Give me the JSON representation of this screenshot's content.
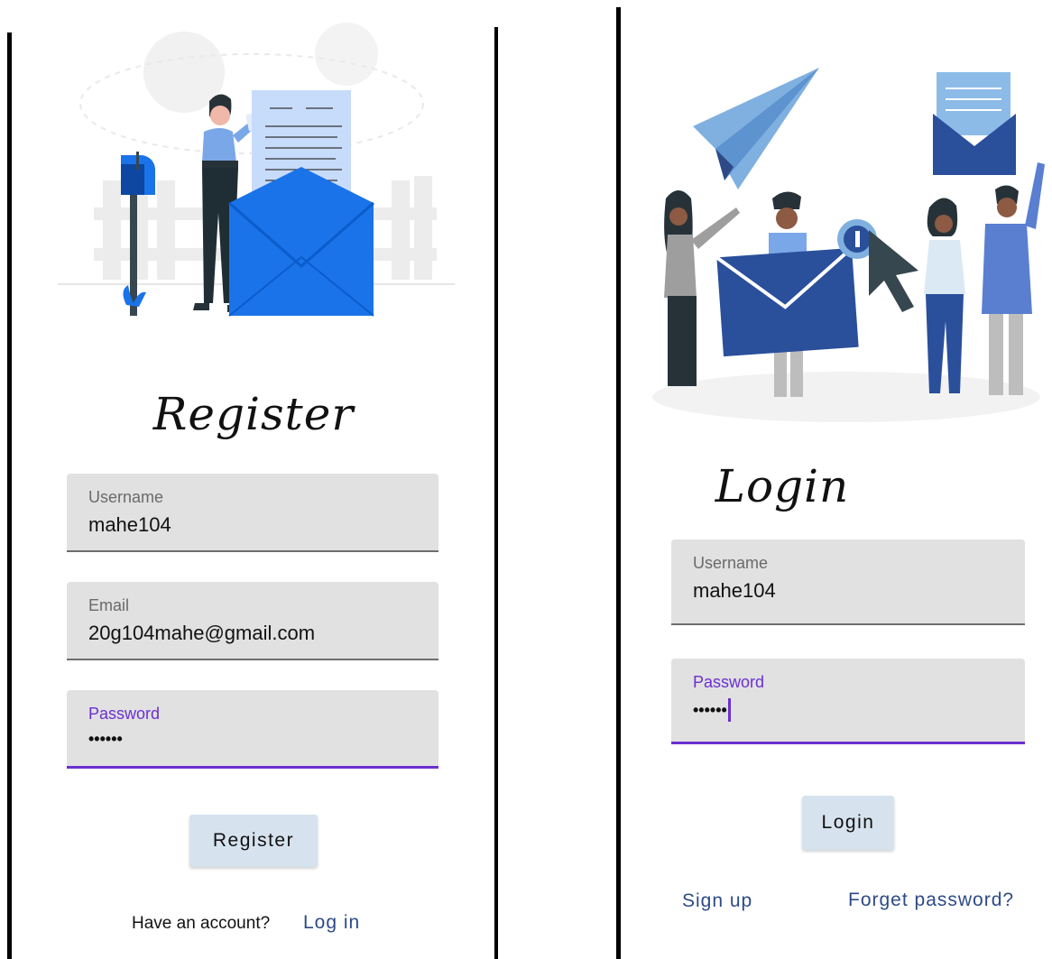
{
  "register": {
    "title": "Register",
    "username": {
      "label": "Username",
      "value": "mahe104"
    },
    "email": {
      "label": "Email",
      "value": "20g104mahe@gmail.com"
    },
    "password": {
      "label": "Password",
      "value": "••••••"
    },
    "submit_label": "Register",
    "have_account_text": "Have an account?",
    "login_link": "Log in"
  },
  "login": {
    "title": "Login",
    "username": {
      "label": "Username",
      "value": "mahe104"
    },
    "password": {
      "label": "Password",
      "value": "••••••"
    },
    "submit_label": "Login",
    "signup_link": "Sign up",
    "forgot_link": "Forget password?"
  },
  "colors": {
    "accent_purple": "#6b2fd1",
    "field_bg": "#e1e1e1",
    "button_bg": "#d6e3ef",
    "link_blue": "#2d4a87",
    "illustration_blue": "#1a73e8"
  },
  "icons": {
    "register_illustration": "woman-mailbox-envelope-illustration",
    "login_illustration": "people-envelopes-paper-plane-illustration"
  }
}
